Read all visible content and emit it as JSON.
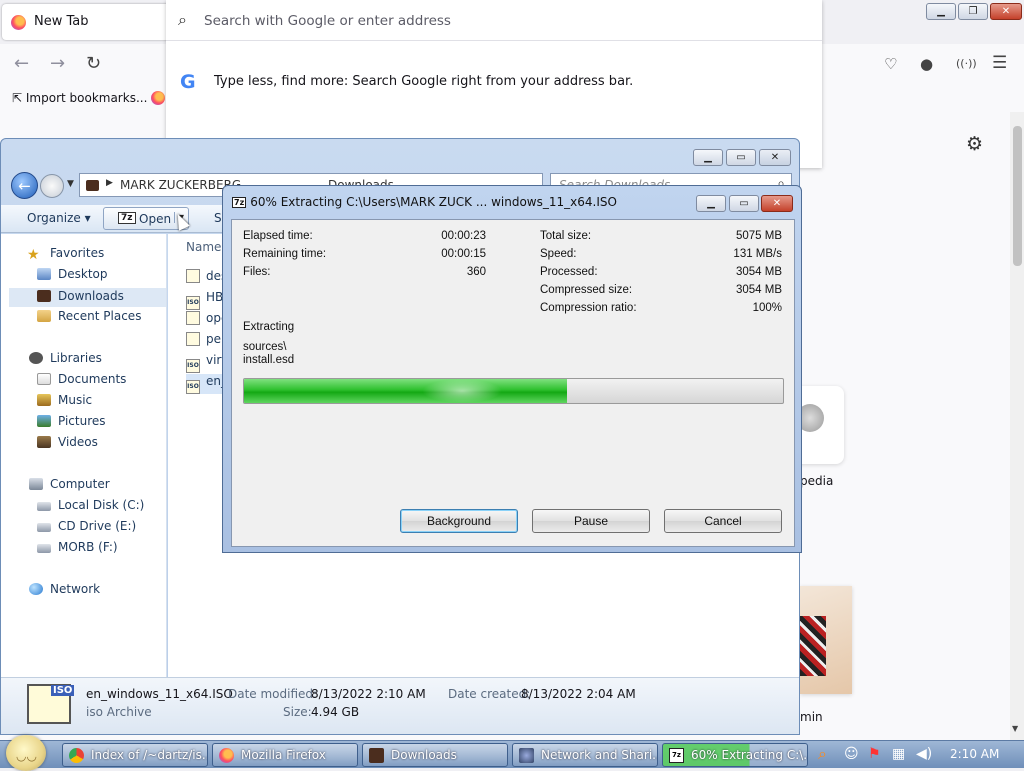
{
  "firefox": {
    "tab_title": "New Tab",
    "tab_close": "✕",
    "new_tab": "+",
    "window_min": "▁",
    "window_max": "❐",
    "window_close": "✕",
    "back": "←",
    "forward": "→",
    "reload": "↻",
    "search_placeholder": "Search with Google or enter address",
    "suggestion_logo": "G",
    "suggestion_tip": "Type less, find more: Search Google right from your address bar.",
    "bookmarks_import": "Import bookmarks...",
    "tile_wiki_label": "pedia",
    "tile_photo_label": "min",
    "colors": {
      "accent": "#0060df",
      "chrome_bg": "#f0f0f4"
    }
  },
  "explorer": {
    "window_min": "▁",
    "window_max": "▭",
    "window_close": "✕",
    "address": {
      "crumb_user": "MARK ZUCKERBERG",
      "crumb_folder": "Downloads"
    },
    "search_placeholder": "Search Downloads",
    "toolbar": {
      "organize": "Organize ▾",
      "open_badge": "7z",
      "open": "Open",
      "open_dropdown": "▾",
      "more": "Sh"
    },
    "nav": {
      "favorites": "Favorites",
      "desktop": "Desktop",
      "downloads": "Downloads",
      "recent": "Recent Places",
      "libraries": "Libraries",
      "documents": "Documents",
      "music": "Music",
      "pictures": "Pictures",
      "videos": "Videos",
      "computer": "Computer",
      "local_disk": "Local Disk (C:)",
      "cd_drive": "CD Drive (E:)",
      "morb": "MORB (F:)",
      "network": "Network"
    },
    "column_name": "Name",
    "files": [
      {
        "name": "des",
        "badge": ""
      },
      {
        "name": "HB",
        "badge": "ISO"
      },
      {
        "name": "ope",
        "badge": ""
      },
      {
        "name": "per",
        "badge": ""
      },
      {
        "name": "virt",
        "badge": "ISO"
      },
      {
        "name": "en_",
        "badge": "ISO"
      }
    ],
    "details": {
      "file_name": "en_windows_11_x64.ISO",
      "file_type": "iso Archive",
      "modified_label": "Date modified:",
      "modified_value": "8/13/2022 2:10 AM",
      "created_label": "Date created:",
      "created_value": "8/13/2022 2:04 AM",
      "size_label": "Size:",
      "size_value": "4.94 GB",
      "icon_badge": "ISO"
    }
  },
  "zip": {
    "title_badge": "7z",
    "title": "60% Extracting C:\\Users\\MARK ZUCK ... windows_11_x64.ISO",
    "window_min": "▁",
    "window_max": "▭",
    "window_close": "✕",
    "elapsed_label": "Elapsed time:",
    "elapsed_value": "00:00:23",
    "remaining_label": "Remaining time:",
    "remaining_value": "00:00:15",
    "files_label": "Files:",
    "files_value": "360",
    "total_label": "Total size:",
    "total_value": "5075 MB",
    "speed_label": "Speed:",
    "speed_value": "131 MB/s",
    "processed_label": "Processed:",
    "processed_value": "3054 MB",
    "compressed_label": "Compressed size:",
    "compressed_value": "3054 MB",
    "ratio_label": "Compression ratio:",
    "ratio_value": "100%",
    "status": "Extracting",
    "path_line1": "sources\\",
    "path_line2": "install.esd",
    "progress_fraction": 0.6,
    "background_btn": "Background",
    "pause_btn": "Pause",
    "cancel_btn": "Cancel"
  },
  "taskbar": {
    "chrome": "Index of /~dartz/is...",
    "firefox": "Mozilla Firefox",
    "downloads": "Downloads",
    "network": "Network and Shari...",
    "zip_badge": "7z",
    "zip": "60% Extracting C:\\...",
    "clock": "2:10 AM"
  }
}
